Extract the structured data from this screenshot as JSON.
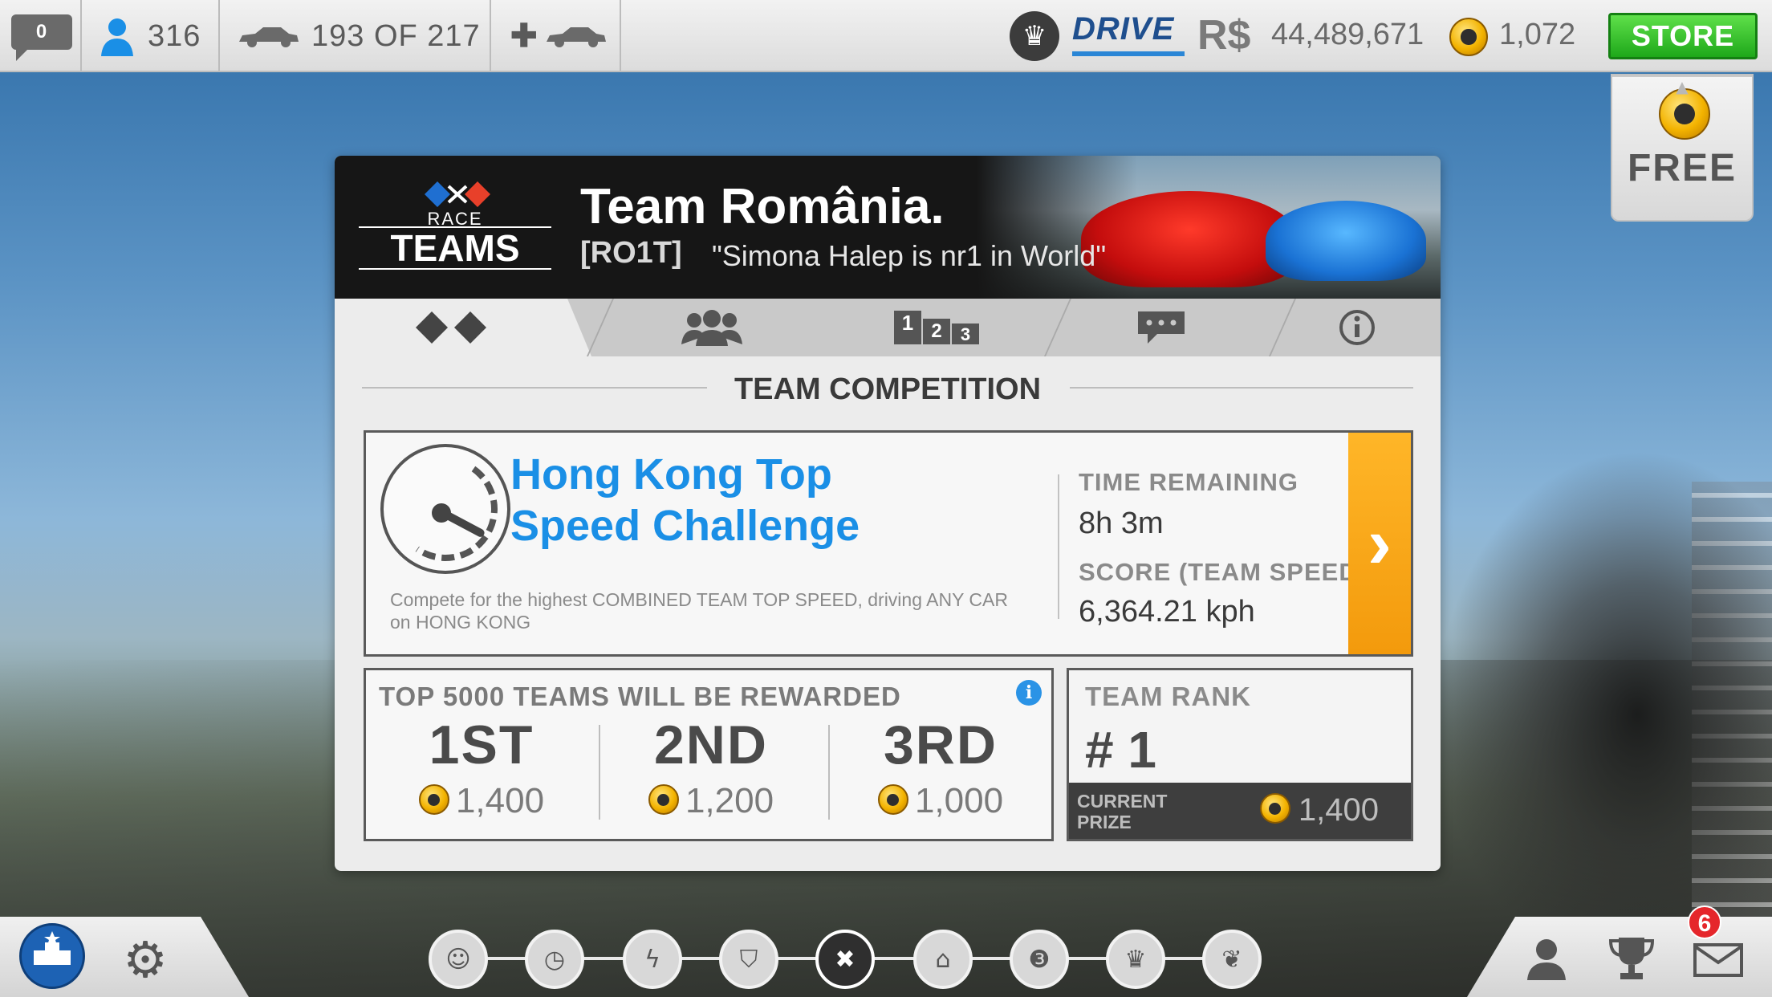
{
  "topbar": {
    "messages_count": "0",
    "level": "316",
    "cars_owned": "193 OF 217",
    "drive_label": "DRIVE",
    "currency_symbol": "R$",
    "cash": "44,489,671",
    "gold": "1,072",
    "store_label": "STORE"
  },
  "free_offer": {
    "label": "FREE"
  },
  "header": {
    "logo_race": "RACE",
    "logo_teams": "TEAMS",
    "team_name": "Team România.",
    "team_tag": "[RO1T]",
    "team_motto": "\"Simona Halep is nr1 in World\""
  },
  "tabs": [
    {
      "icon": "race-flags-icon",
      "active": true
    },
    {
      "icon": "members-icon",
      "active": false
    },
    {
      "icon": "leaderboard-icon",
      "active": false,
      "digits": [
        "1",
        "2",
        "3"
      ]
    },
    {
      "icon": "chat-icon",
      "active": false
    },
    {
      "icon": "info-icon",
      "active": false
    }
  ],
  "section": {
    "title": "TEAM COMPETITION"
  },
  "event": {
    "title": "Hong Kong Top Speed Challenge",
    "description": "Compete for the highest COMBINED TEAM TOP SPEED, driving ANY CAR on HONG KONG",
    "time_label": "TIME REMAINING",
    "time_value": "8h 3m",
    "score_label": "SCORE (TEAM SPEED)",
    "score_value": "6,364.21 kph"
  },
  "rewards": {
    "title": "TOP 5000 TEAMS WILL BE REWARDED",
    "places": [
      {
        "place": "1ST",
        "amount": "1,400"
      },
      {
        "place": "2ND",
        "amount": "1,200"
      },
      {
        "place": "3RD",
        "amount": "1,000"
      }
    ]
  },
  "rank": {
    "label": "TEAM RANK",
    "value": "# 1",
    "current_prize_label": "CURRENT PRIZE",
    "current_prize_value": "1,400"
  },
  "bottom_nav": {
    "mail_badge": "6",
    "items": [
      "team-icon",
      "stopwatch-icon",
      "lightning-icon",
      "shield-icon",
      "race-flags-icon",
      "garage-icon",
      "number-3-icon",
      "crown-icon",
      "laurel-trophy-icon"
    ]
  },
  "colors": {
    "accent_blue": "#1a8fe6",
    "store_green": "#1ea81a",
    "arrow_orange": "#f39a0c"
  }
}
